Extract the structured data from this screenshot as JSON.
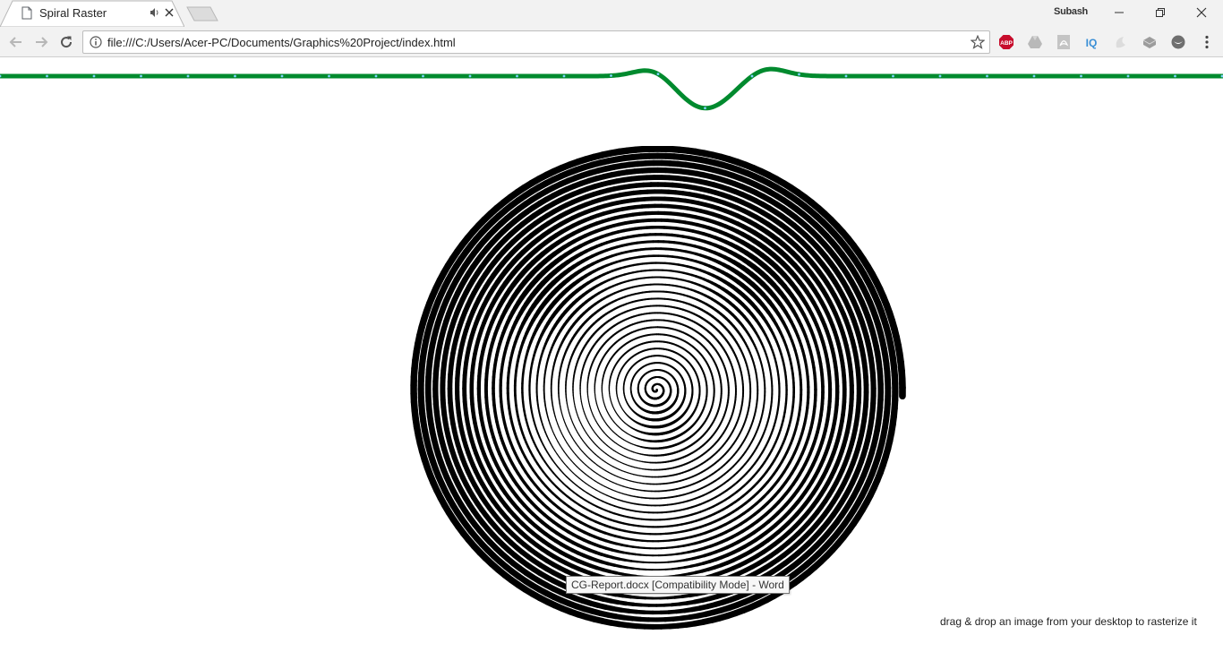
{
  "browser": {
    "tab": {
      "title": "Spiral Raster",
      "favicon": "page-icon",
      "audio_icon": "speaker-icon",
      "close_icon": "close-icon"
    },
    "profile_name": "Subash",
    "window_controls": [
      "minimize-icon",
      "restore-icon",
      "close-icon"
    ],
    "address_bar": {
      "url": "file:///C:/Users/Acer-PC/Documents/Graphics%20Project/index.html",
      "info_icon": "info-icon",
      "bookmark_icon": "star-icon"
    },
    "nav": [
      "back-arrow-icon",
      "forward-arrow-icon",
      "reload-icon"
    ],
    "extensions": [
      {
        "name": "adblock-plus-icon",
        "label": "ABP",
        "color": "#c70d2c"
      },
      {
        "name": "google-drive-icon"
      },
      {
        "name": "pdf-icon"
      },
      {
        "name": "iq-icon",
        "label": "IQ",
        "color": "#3a8fd6"
      },
      {
        "name": "extension-icon"
      },
      {
        "name": "extension-icon"
      },
      {
        "name": "extension-icon"
      }
    ],
    "menu_icon": "kebab-menu-icon"
  },
  "page": {
    "wave_color": "#008a2e",
    "hint_text": "drag & drop an image from your desktop to rasterize it"
  },
  "tooltip": {
    "text": "CG-Report.docx [Compatibility Mode] - Word"
  }
}
